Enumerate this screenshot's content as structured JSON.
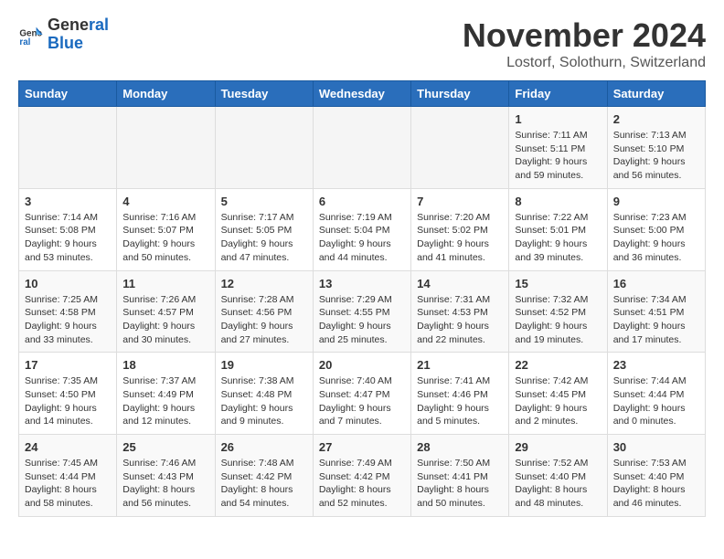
{
  "header": {
    "logo_line1": "General",
    "logo_line2": "Blue",
    "month": "November 2024",
    "location": "Lostorf, Solothurn, Switzerland"
  },
  "weekdays": [
    "Sunday",
    "Monday",
    "Tuesday",
    "Wednesday",
    "Thursday",
    "Friday",
    "Saturday"
  ],
  "weeks": [
    [
      {
        "day": "",
        "info": ""
      },
      {
        "day": "",
        "info": ""
      },
      {
        "day": "",
        "info": ""
      },
      {
        "day": "",
        "info": ""
      },
      {
        "day": "",
        "info": ""
      },
      {
        "day": "1",
        "info": "Sunrise: 7:11 AM\nSunset: 5:11 PM\nDaylight: 9 hours and 59 minutes."
      },
      {
        "day": "2",
        "info": "Sunrise: 7:13 AM\nSunset: 5:10 PM\nDaylight: 9 hours and 56 minutes."
      }
    ],
    [
      {
        "day": "3",
        "info": "Sunrise: 7:14 AM\nSunset: 5:08 PM\nDaylight: 9 hours and 53 minutes."
      },
      {
        "day": "4",
        "info": "Sunrise: 7:16 AM\nSunset: 5:07 PM\nDaylight: 9 hours and 50 minutes."
      },
      {
        "day": "5",
        "info": "Sunrise: 7:17 AM\nSunset: 5:05 PM\nDaylight: 9 hours and 47 minutes."
      },
      {
        "day": "6",
        "info": "Sunrise: 7:19 AM\nSunset: 5:04 PM\nDaylight: 9 hours and 44 minutes."
      },
      {
        "day": "7",
        "info": "Sunrise: 7:20 AM\nSunset: 5:02 PM\nDaylight: 9 hours and 41 minutes."
      },
      {
        "day": "8",
        "info": "Sunrise: 7:22 AM\nSunset: 5:01 PM\nDaylight: 9 hours and 39 minutes."
      },
      {
        "day": "9",
        "info": "Sunrise: 7:23 AM\nSunset: 5:00 PM\nDaylight: 9 hours and 36 minutes."
      }
    ],
    [
      {
        "day": "10",
        "info": "Sunrise: 7:25 AM\nSunset: 4:58 PM\nDaylight: 9 hours and 33 minutes."
      },
      {
        "day": "11",
        "info": "Sunrise: 7:26 AM\nSunset: 4:57 PM\nDaylight: 9 hours and 30 minutes."
      },
      {
        "day": "12",
        "info": "Sunrise: 7:28 AM\nSunset: 4:56 PM\nDaylight: 9 hours and 27 minutes."
      },
      {
        "day": "13",
        "info": "Sunrise: 7:29 AM\nSunset: 4:55 PM\nDaylight: 9 hours and 25 minutes."
      },
      {
        "day": "14",
        "info": "Sunrise: 7:31 AM\nSunset: 4:53 PM\nDaylight: 9 hours and 22 minutes."
      },
      {
        "day": "15",
        "info": "Sunrise: 7:32 AM\nSunset: 4:52 PM\nDaylight: 9 hours and 19 minutes."
      },
      {
        "day": "16",
        "info": "Sunrise: 7:34 AM\nSunset: 4:51 PM\nDaylight: 9 hours and 17 minutes."
      }
    ],
    [
      {
        "day": "17",
        "info": "Sunrise: 7:35 AM\nSunset: 4:50 PM\nDaylight: 9 hours and 14 minutes."
      },
      {
        "day": "18",
        "info": "Sunrise: 7:37 AM\nSunset: 4:49 PM\nDaylight: 9 hours and 12 minutes."
      },
      {
        "day": "19",
        "info": "Sunrise: 7:38 AM\nSunset: 4:48 PM\nDaylight: 9 hours and 9 minutes."
      },
      {
        "day": "20",
        "info": "Sunrise: 7:40 AM\nSunset: 4:47 PM\nDaylight: 9 hours and 7 minutes."
      },
      {
        "day": "21",
        "info": "Sunrise: 7:41 AM\nSunset: 4:46 PM\nDaylight: 9 hours and 5 minutes."
      },
      {
        "day": "22",
        "info": "Sunrise: 7:42 AM\nSunset: 4:45 PM\nDaylight: 9 hours and 2 minutes."
      },
      {
        "day": "23",
        "info": "Sunrise: 7:44 AM\nSunset: 4:44 PM\nDaylight: 9 hours and 0 minutes."
      }
    ],
    [
      {
        "day": "24",
        "info": "Sunrise: 7:45 AM\nSunset: 4:44 PM\nDaylight: 8 hours and 58 minutes."
      },
      {
        "day": "25",
        "info": "Sunrise: 7:46 AM\nSunset: 4:43 PM\nDaylight: 8 hours and 56 minutes."
      },
      {
        "day": "26",
        "info": "Sunrise: 7:48 AM\nSunset: 4:42 PM\nDaylight: 8 hours and 54 minutes."
      },
      {
        "day": "27",
        "info": "Sunrise: 7:49 AM\nSunset: 4:42 PM\nDaylight: 8 hours and 52 minutes."
      },
      {
        "day": "28",
        "info": "Sunrise: 7:50 AM\nSunset: 4:41 PM\nDaylight: 8 hours and 50 minutes."
      },
      {
        "day": "29",
        "info": "Sunrise: 7:52 AM\nSunset: 4:40 PM\nDaylight: 8 hours and 48 minutes."
      },
      {
        "day": "30",
        "info": "Sunrise: 7:53 AM\nSunset: 4:40 PM\nDaylight: 8 hours and 46 minutes."
      }
    ]
  ]
}
